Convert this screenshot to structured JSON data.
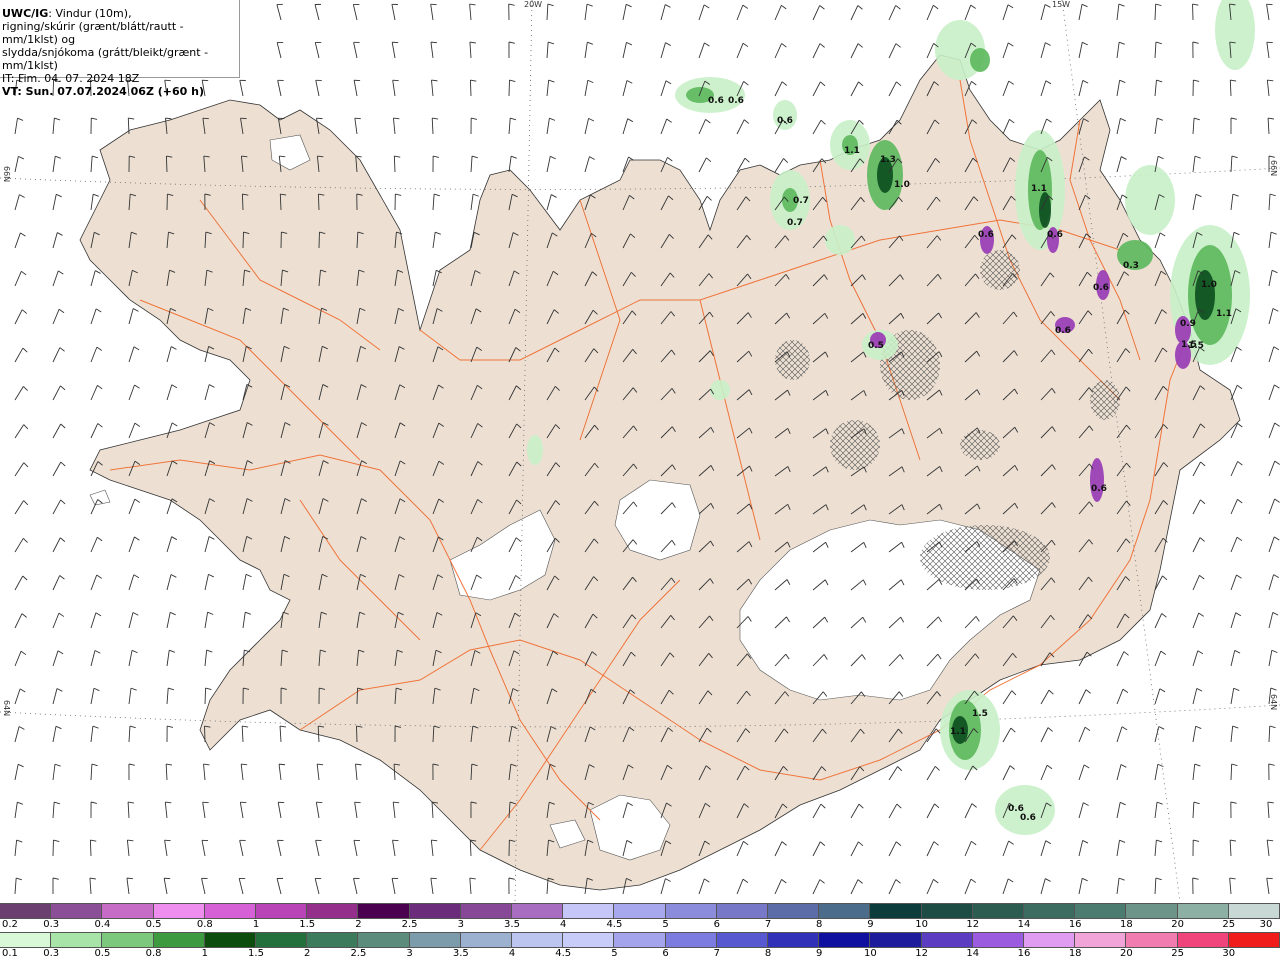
{
  "title": {
    "model": "UWC/IG",
    "line1": ": Vindur (10m),",
    "line2": "rigning/skúrir (grænt/blátt/rautt - mm/1klst) og",
    "line3": "slydda/snjókoma (grátt/bleikt/grænt - mm/1klst)",
    "init": "IT: Fim. 04. 07. 2024 18Z",
    "valid": "VT: Sun. 07.07.2024 06Z (+60 h)"
  },
  "grid_labels": {
    "lon_20w": "20W",
    "lon_15w": "15W",
    "lat_66n_left": "66N",
    "lat_66n_right": "66N",
    "lat_64n_left": "64N",
    "lat_64n_right": "64N"
  },
  "colors": {
    "land": "#ede0d3",
    "ice": "#ffffff",
    "road": "#f0682a",
    "barb": "#333333",
    "rain_light": "#c8f0c8",
    "rain_mid": "#5cb85c",
    "rain_dark": "#0a4d1e",
    "snow": "#9b3fb5"
  },
  "precip_values": [
    "0.6",
    "0.6",
    "0.6",
    "1.1",
    "1.3",
    "1.0",
    "0.7",
    "0.7",
    "0.6",
    "0.6",
    "1.1",
    "0.3",
    "0.6",
    "0.6",
    "1.0",
    "0.9",
    "1.1",
    "1.5",
    "0.5",
    "1.5",
    "0.6",
    "1.5",
    "1.1",
    "0.6",
    "0.6"
  ],
  "legend_snow": {
    "ticks": [
      "0.2",
      "0.3",
      "0.4",
      "0.5",
      "0.8",
      "1",
      "1.5",
      "2",
      "2.5",
      "3",
      "3.5",
      "4",
      "4.5",
      "5",
      "6",
      "7",
      "8",
      "9",
      "10",
      "12",
      "14",
      "16",
      "18",
      "20",
      "25",
      "30"
    ],
    "colors": [
      "#6b3f70",
      "#8a4f96",
      "#c66cc6",
      "#f08ef0",
      "#d660d6",
      "#b844b8",
      "#94308c",
      "#4b0050",
      "#6c2c7c",
      "#884898",
      "#a86cc0",
      "#c6c6f8",
      "#a8a8ee",
      "#8c8cdc",
      "#7878c8",
      "#5c6ca8",
      "#4c6c8c",
      "#0c3c3c",
      "#1c4c44",
      "#2c5c50",
      "#3c6c60",
      "#4c7c70",
      "#6c9488",
      "#8cb0a4",
      "#c8d8d4"
    ]
  },
  "legend_rain": {
    "ticks": [
      "0.1",
      "0.3",
      "0.5",
      "0.8",
      "1",
      "1.5",
      "2",
      "2.5",
      "3",
      "3.5",
      "4",
      "4.5",
      "5",
      "6",
      "7",
      "8",
      "9",
      "10",
      "12",
      "14",
      "16",
      "18",
      "20",
      "25",
      "30"
    ],
    "colors": [
      "#d8f8d8",
      "#a8e4a8",
      "#7cc87c",
      "#3e9a3e",
      "#0c4c0c",
      "#24703c",
      "#3c7c5c",
      "#5c8c7c",
      "#7c9cac",
      "#9cb0d0",
      "#bcc4f0",
      "#c8ccf8",
      "#a4a4ec",
      "#7c7ce0",
      "#5858d0",
      "#3030b8",
      "#1010a0",
      "#1c1c9c",
      "#5c3cc0",
      "#9c5ce0",
      "#e09cf0",
      "#f0a4d8",
      "#f07cb0",
      "#f0447c",
      "#f01c1c"
    ]
  }
}
